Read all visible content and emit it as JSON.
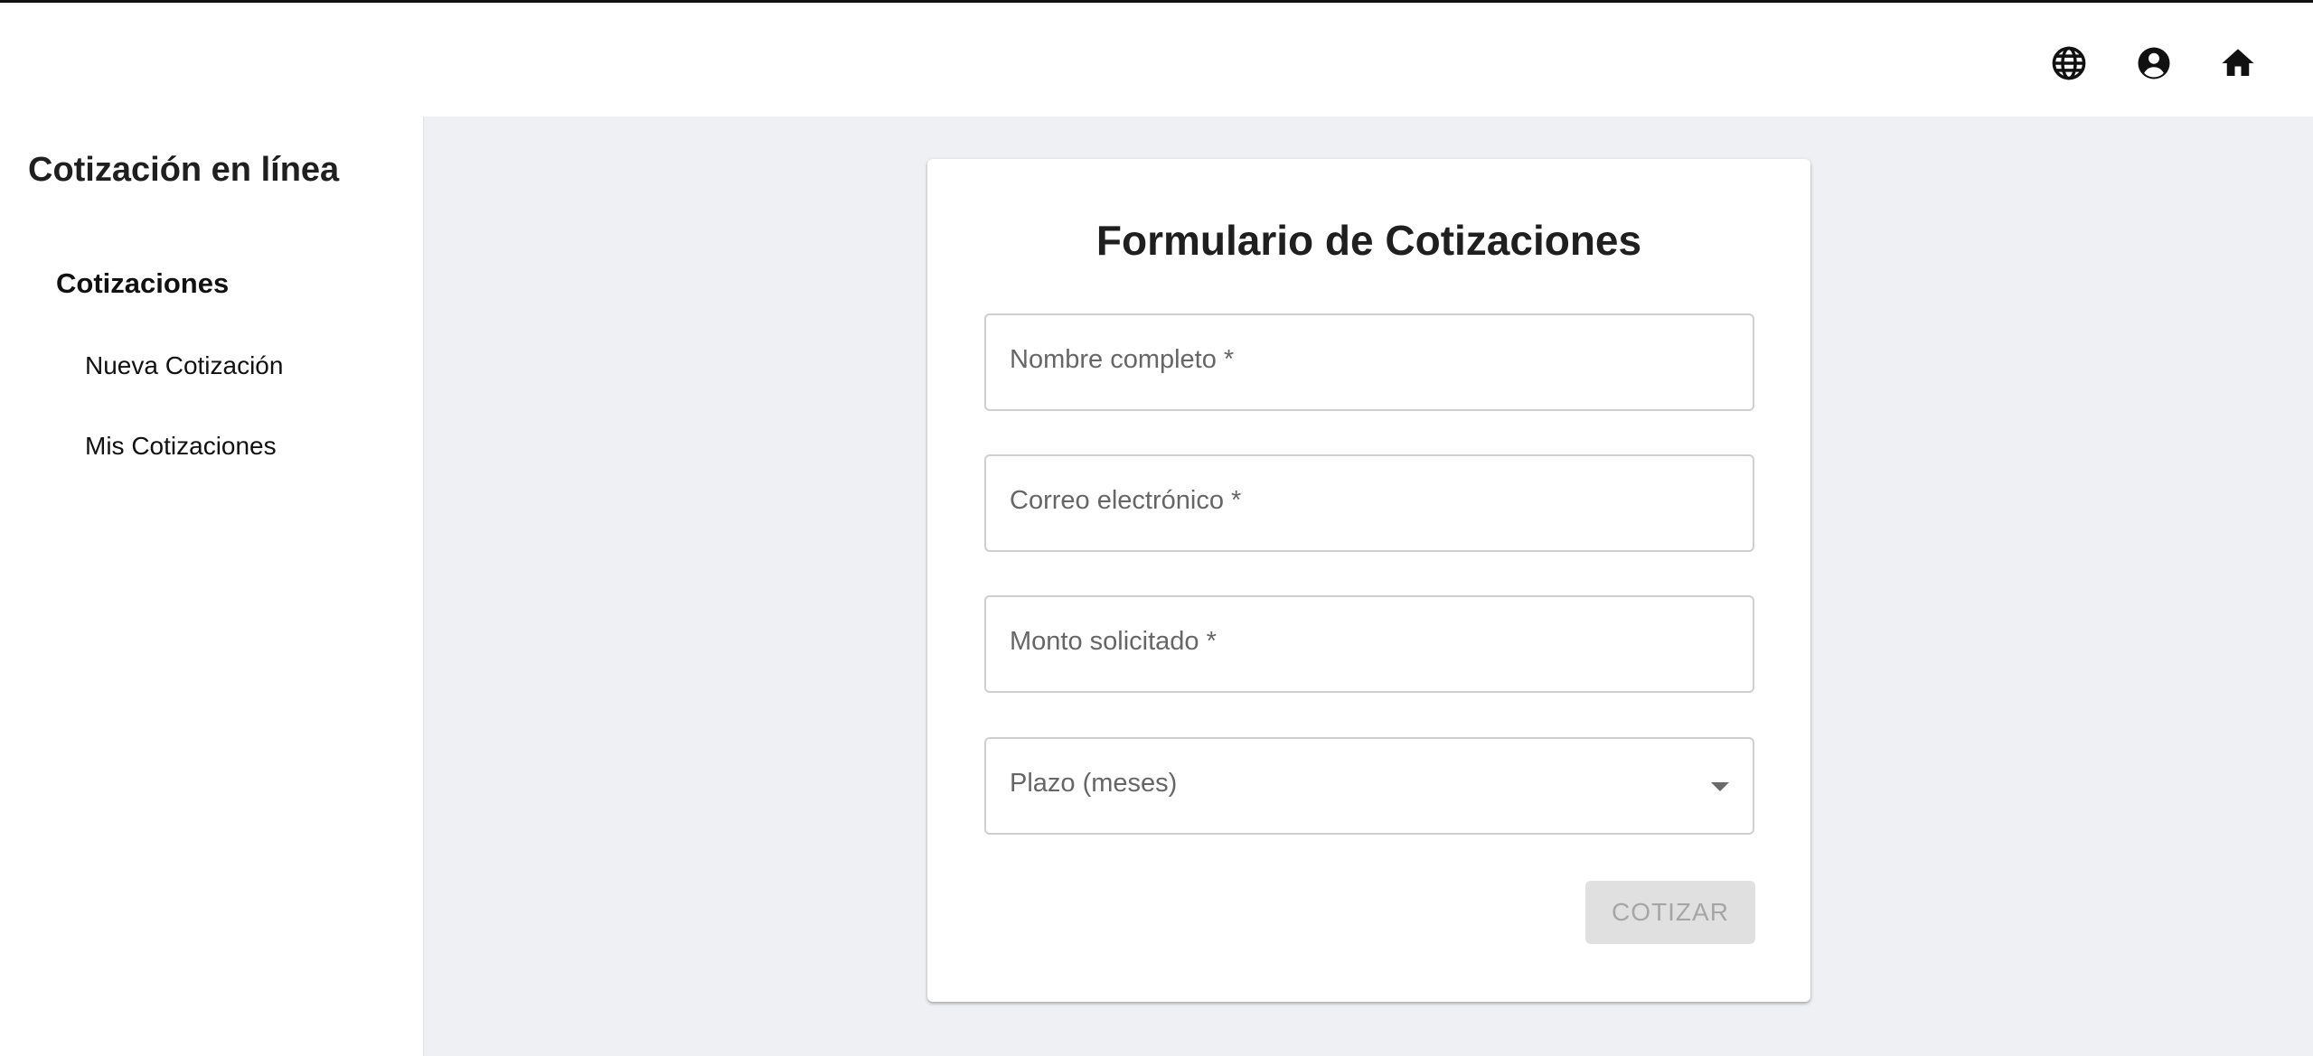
{
  "header": {
    "icons": [
      "language-icon",
      "account-icon",
      "home-icon"
    ]
  },
  "sidebar": {
    "app_title": "Cotización en línea",
    "section_title": "Cotizaciones",
    "items": [
      {
        "label": "Nueva Cotización"
      },
      {
        "label": "Mis Cotizaciones"
      }
    ]
  },
  "form": {
    "title": "Formulario de Cotizaciones",
    "fields": [
      {
        "label": "Nombre completo *",
        "value": ""
      },
      {
        "label": "Correo electrónico *",
        "value": ""
      },
      {
        "label": "Monto solicitado *",
        "value": ""
      },
      {
        "label": "Plazo (meses)",
        "value": ""
      }
    ],
    "submit_label": "COTIZAR",
    "submit_disabled": true
  },
  "colors": {
    "main_background": "#eff0f3",
    "card_background": "#ffffff",
    "disabled_button": "#e0e0e0",
    "disabled_text": "#a6a6a6"
  }
}
